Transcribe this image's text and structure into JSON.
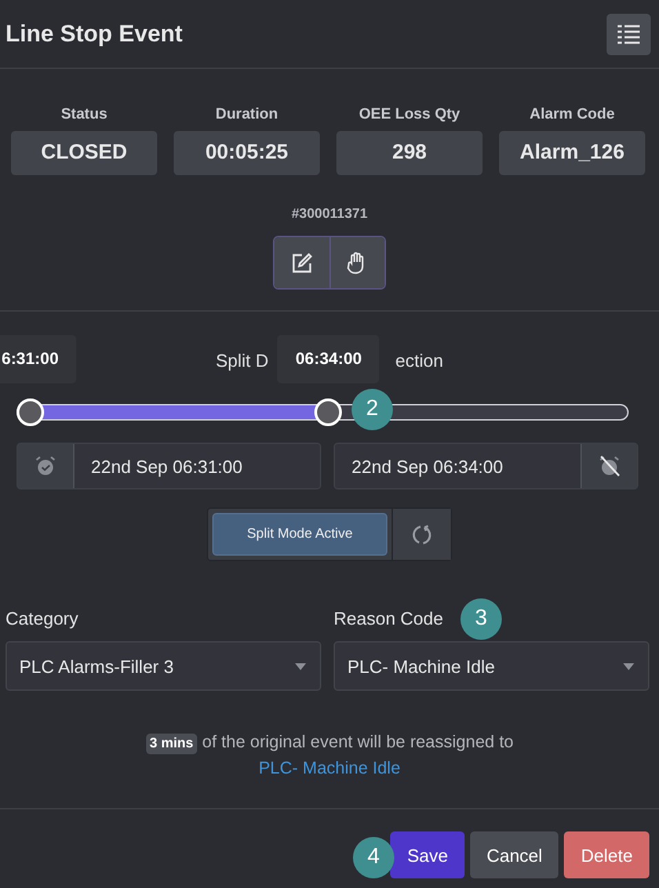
{
  "header": {
    "title": "Line Stop Event"
  },
  "stats": [
    {
      "label": "Status",
      "value": "CLOSED"
    },
    {
      "label": "Duration",
      "value": "00:05:25"
    },
    {
      "label": "OEE Loss Qty",
      "value": "298"
    },
    {
      "label": "Alarm Code",
      "value": "Alarm_126"
    }
  ],
  "event_id": "#300011371",
  "split": {
    "heading_parts": [
      "Split D",
      "ection"
    ],
    "thumbs": [
      {
        "level": 0.02,
        "tooltip": "6:31:00"
      },
      {
        "level": 0.51,
        "tooltip": "06:34:00"
      }
    ],
    "start_field": {
      "value": "22nd Sep 06:31:00"
    },
    "end_field": {
      "value": "22nd Sep 06:34:00"
    },
    "mode_button": {
      "label": "Split Mode Active",
      "selected": true
    }
  },
  "category": {
    "label": "Category",
    "value": "PLC Alarms-Filler 3"
  },
  "reason_code": {
    "label": "Reason Code",
    "value": "PLC- Machine Idle"
  },
  "message": "**3 mins** of the original event will be reassigned to",
  "message_link": "PLC- Machine Idle",
  "buttons": [
    {
      "label": "Save",
      "kind": "primary"
    },
    {
      "label": "Cancel",
      "kind": "secondary"
    },
    {
      "label": "Delete",
      "kind": "danger"
    }
  ],
  "step_badges": [
    {
      "label": "2",
      "kind": "slider"
    },
    {
      "label": "3",
      "kind": "reason"
    },
    {
      "label": "4",
      "kind": "save"
    }
  ]
}
